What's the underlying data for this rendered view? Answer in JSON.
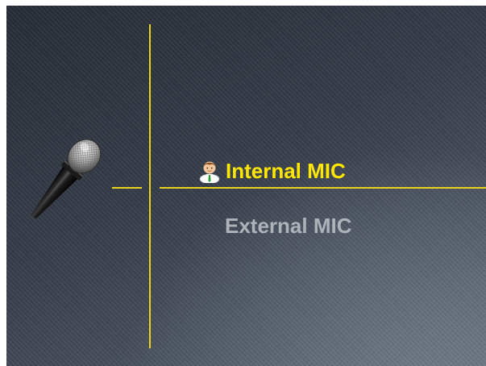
{
  "menu": {
    "items": [
      {
        "label": "Internal MIC",
        "selected": true
      },
      {
        "label": "External MIC",
        "selected": false
      }
    ]
  },
  "icons": {
    "device": "microphone-icon",
    "selection": "user-icon"
  },
  "colors": {
    "selected_text": "#ffe600",
    "unselected_text": "#aeb3ba",
    "divider": "#e8d21a",
    "background_dark": "#262c36",
    "background_light": "#5f6874"
  }
}
